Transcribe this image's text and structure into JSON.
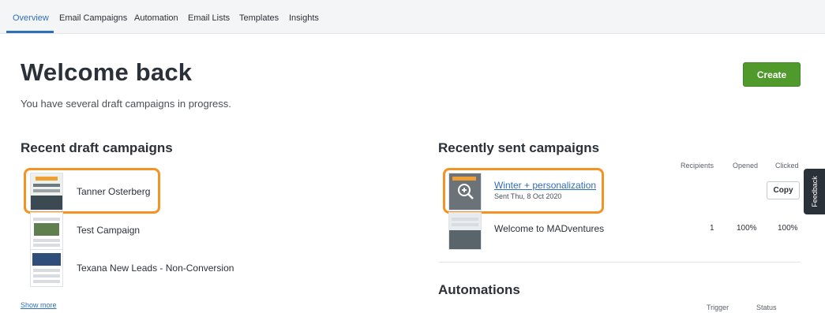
{
  "nav": {
    "tabs": [
      {
        "label": "Overview"
      },
      {
        "label": "Email Campaigns"
      },
      {
        "label": "Automation"
      },
      {
        "label": "Email Lists"
      },
      {
        "label": "Templates"
      },
      {
        "label": "Insights"
      }
    ]
  },
  "header": {
    "title": "Welcome back",
    "subtitle": "You have several draft campaigns in progress.",
    "create_label": "Create"
  },
  "drafts": {
    "heading": "Recent draft campaigns",
    "items": [
      {
        "name": "Tanner Osterberg"
      },
      {
        "name": "Test Campaign"
      },
      {
        "name": "Texana New Leads - Non-Conversion"
      }
    ],
    "show_more": "Show more"
  },
  "sent": {
    "heading": "Recently sent campaigns",
    "columns": {
      "recipients": "Recipients",
      "opened": "Opened",
      "clicked": "Clicked"
    },
    "items": [
      {
        "name": "Winter + personalization",
        "date": "Sent Thu, 8 Oct 2020",
        "action": "Copy"
      },
      {
        "name": "Welcome to MADventures",
        "recipients": "1",
        "opened": "100%",
        "clicked": "100%"
      }
    ]
  },
  "automations": {
    "heading": "Automations",
    "columns": {
      "trigger": "Trigger",
      "status": "Status"
    }
  },
  "feedback_label": "Feedback",
  "colors": {
    "accent": "#2f6fb8",
    "create": "#4f9a2b",
    "highlight": "#f39323"
  }
}
